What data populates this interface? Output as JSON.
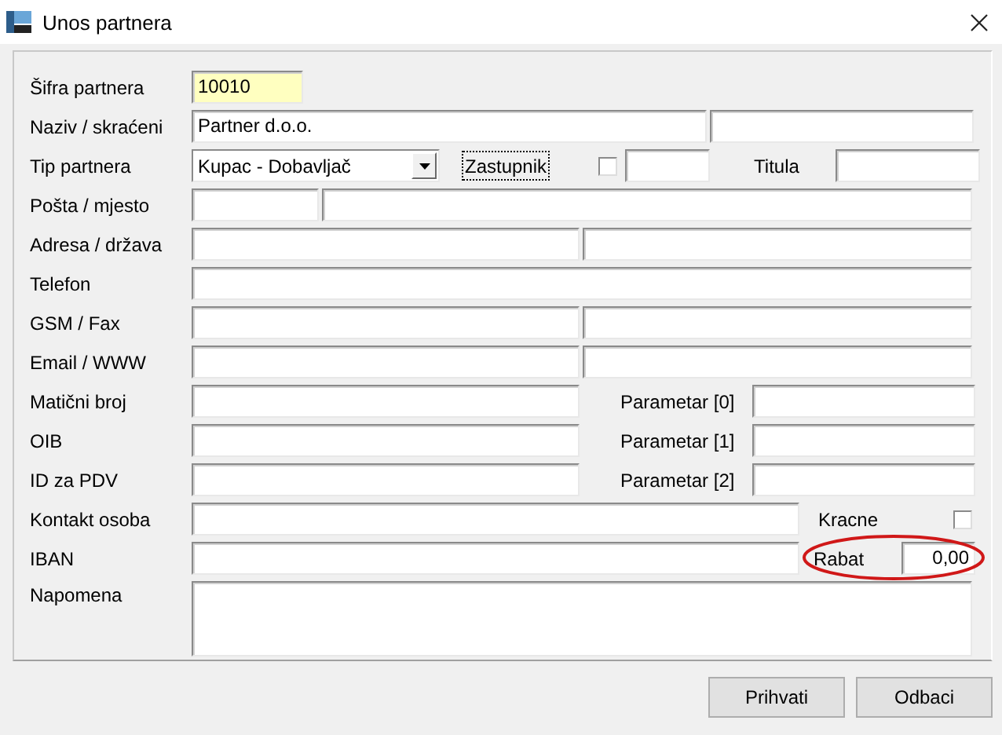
{
  "window": {
    "title": "Unos partnera"
  },
  "form": {
    "rows": [
      {
        "kind": "code",
        "label": "Šifra partnera",
        "value": "10010"
      },
      {
        "kind": "name",
        "label": "Naziv / skraćeni",
        "value": "Partner d.o.o."
      },
      {
        "kind": "type",
        "label": "Tip partnera",
        "value": "Kupac - Dobavljač",
        "button": "Zastupnik",
        "checked": false,
        "extra_label": "Titula"
      },
      {
        "kind": "post",
        "label": "Pošta / mjesto"
      },
      {
        "kind": "pair",
        "label": "Adresa / država"
      },
      {
        "kind": "single",
        "label": "Telefon"
      },
      {
        "kind": "pair",
        "label": "GSM / Fax"
      },
      {
        "kind": "pair",
        "label": "Email / WWW"
      },
      {
        "kind": "param",
        "label": "Matični broj",
        "param_label": "Parametar [0]"
      },
      {
        "kind": "param",
        "label": "OIB",
        "param_label": "Parametar [1]"
      },
      {
        "kind": "param",
        "label": "ID za PDV",
        "param_label": "Parametar [2]"
      },
      {
        "kind": "flag",
        "label": "Kontakt osoba",
        "flag_label": "Kracne",
        "checked": false
      },
      {
        "kind": "discount",
        "label": "IBAN",
        "discount_label": "Rabat",
        "discount": "0,00"
      },
      {
        "kind": "note",
        "label": "Napomena"
      }
    ]
  },
  "buttons": [
    "Prihvati",
    "Odbaci"
  ]
}
